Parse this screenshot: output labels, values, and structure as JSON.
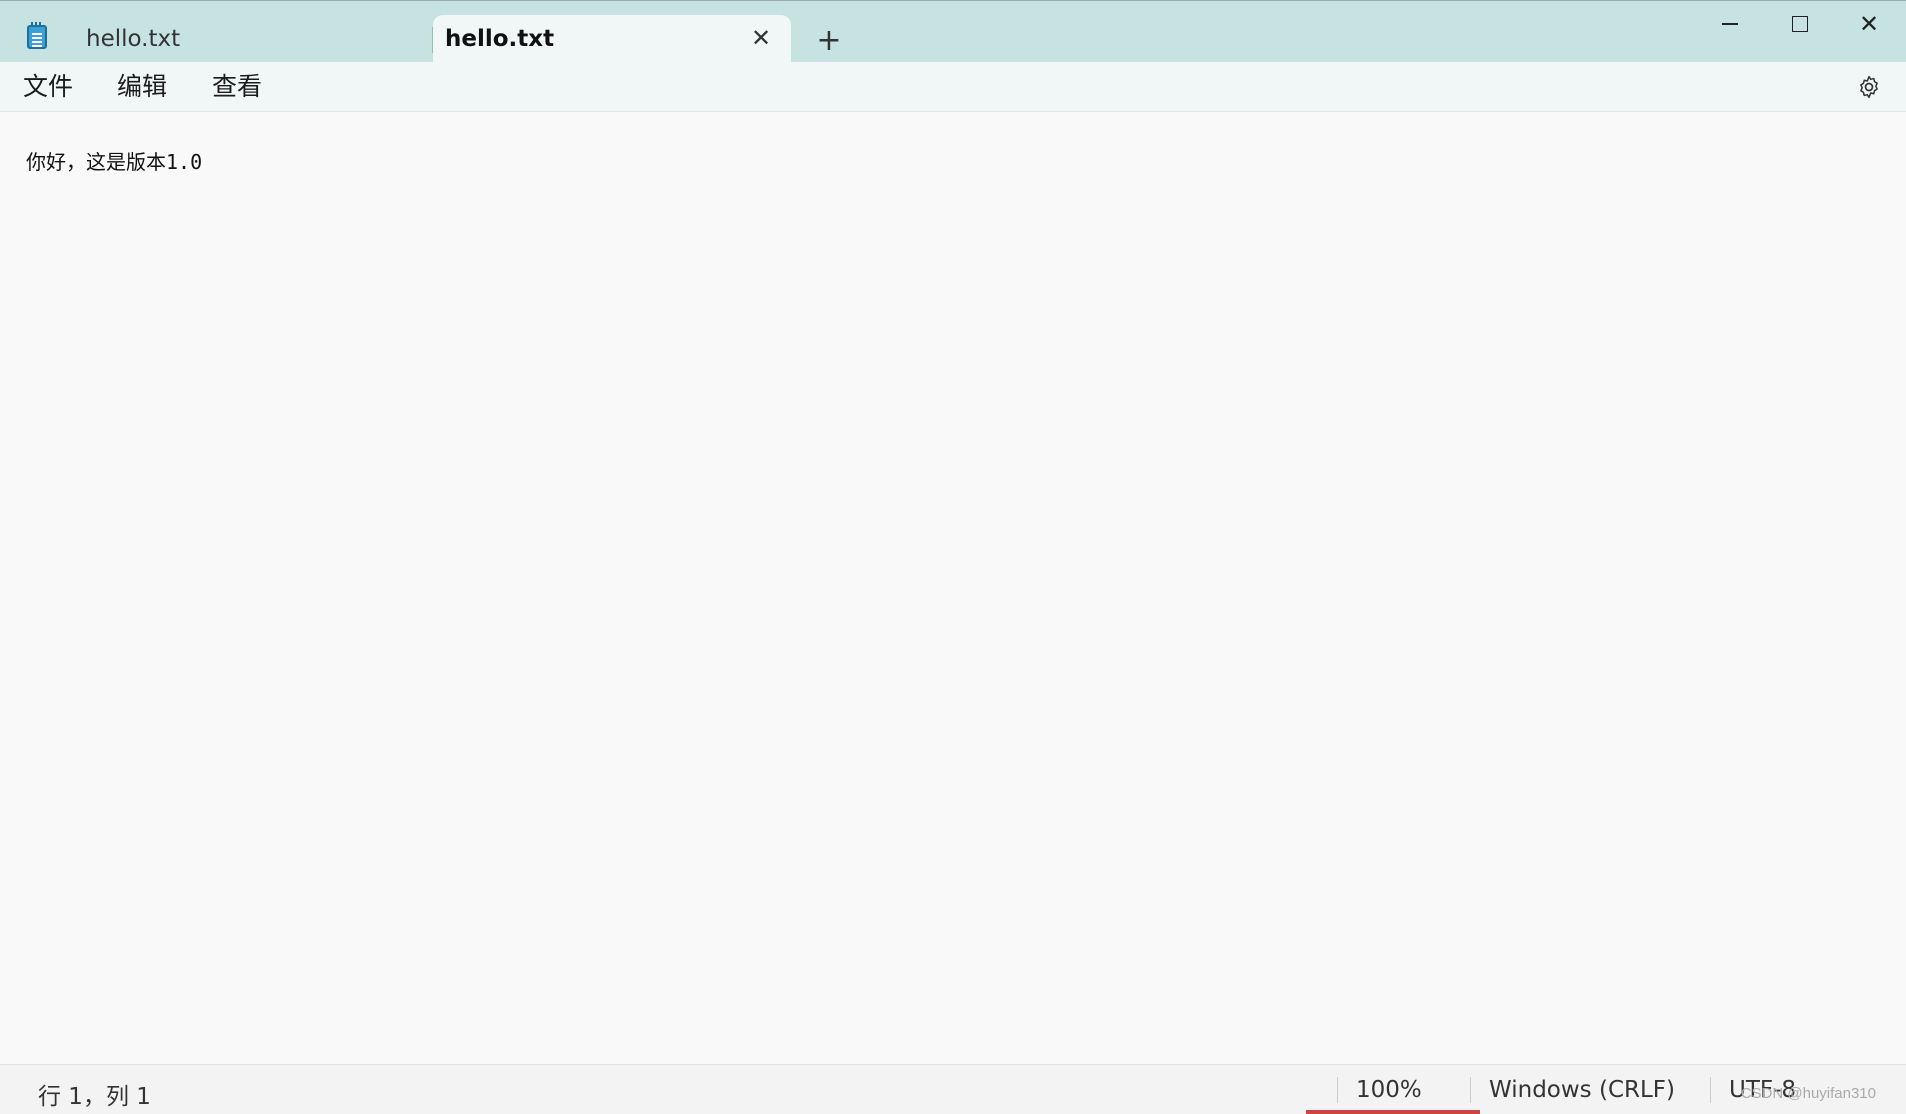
{
  "tabs": [
    {
      "label": "hello.txt",
      "active": false
    },
    {
      "label": "hello.txt",
      "active": true
    }
  ],
  "tab_close_glyph": "✕",
  "new_tab_glyph": "+",
  "window_controls": {
    "close_glyph": "✕"
  },
  "menu": {
    "file": "文件",
    "edit": "编辑",
    "view": "查看"
  },
  "editor": {
    "content": "你好，这是版本1.0"
  },
  "status": {
    "position": "行 1，列 1",
    "zoom": "100%",
    "line_ending": "Windows (CRLF)",
    "encoding": "UTF-8"
  },
  "watermark": "CSDN @huyifan310",
  "icons": [
    "notepad-app-icon",
    "close-icon",
    "plus-icon",
    "minimize-icon",
    "maximize-icon",
    "gear-icon"
  ]
}
